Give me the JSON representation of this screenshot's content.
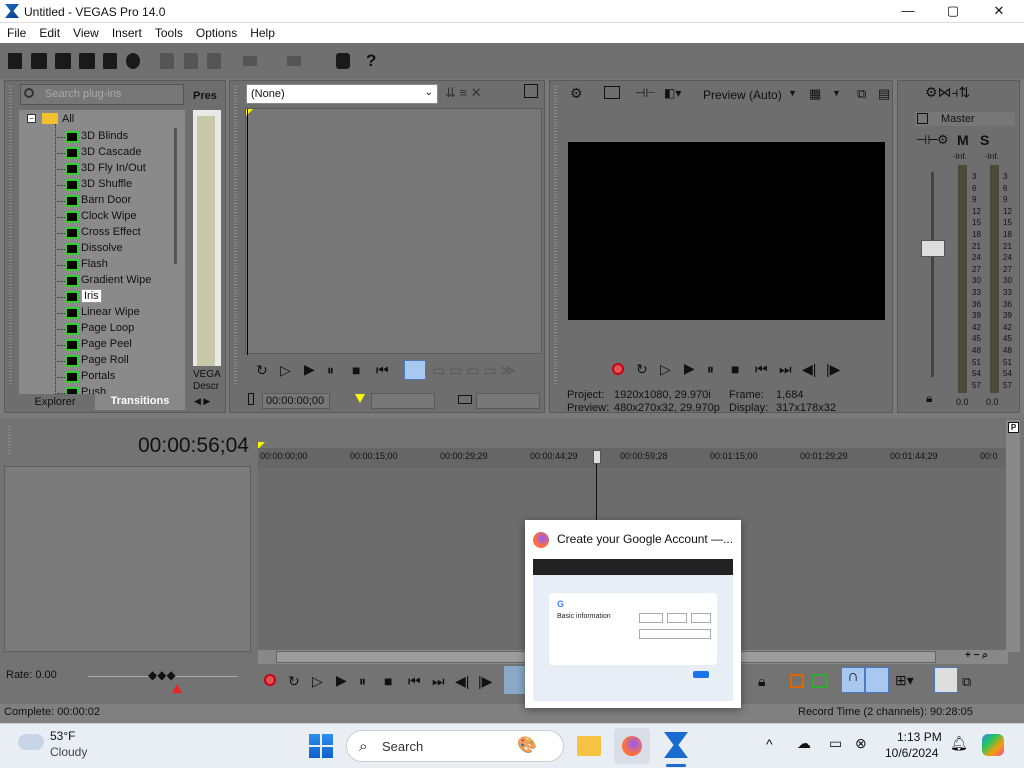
{
  "window": {
    "title": "Untitled - VEGAS Pro 14.0",
    "buttons": [
      "—",
      "▢",
      "✕"
    ]
  },
  "menu": [
    "File",
    "Edit",
    "View",
    "Insert",
    "Tools",
    "Options",
    "Help"
  ],
  "explorer": {
    "search_placeholder": "Search plug-ins",
    "header_label": "Pres",
    "root": "All",
    "items": [
      "3D Blinds",
      "3D Cascade",
      "3D Fly In/Out",
      "3D Shuffle",
      "Barn Door",
      "Clock Wipe",
      "Cross Effect",
      "Dissolve",
      "Flash",
      "Gradient Wipe",
      "Iris",
      "Linear Wipe",
      "Page Loop",
      "Page Peel",
      "Page Roll",
      "Portals",
      "Push"
    ],
    "selected": "Iris",
    "side_text": [
      "VEGA",
      "Descr"
    ],
    "tabs": [
      "Explorer",
      "Transitions"
    ]
  },
  "trimmer": {
    "dropdown": "(None)",
    "timecode": "00:00:00;00"
  },
  "preview": {
    "mode_label": "Preview (Auto)",
    "project_label": "Project:",
    "project_value": "1920x1080, 29.970i",
    "preview_label": "Preview:",
    "preview_value": "480x270x32, 29.970p",
    "frame_label": "Frame:",
    "frame_value": "1,684",
    "display_label": "Display:",
    "display_value": "317x178x32"
  },
  "master": {
    "title": "Master",
    "m": "M",
    "s": "S",
    "peak_left": "-Inf.",
    "peak_right": "-Inf.",
    "ticks": [
      "3",
      "6",
      "9",
      "12",
      "15",
      "18",
      "21",
      "24",
      "27",
      "30",
      "33",
      "36",
      "39",
      "42",
      "45",
      "48",
      "51",
      "54",
      "57"
    ],
    "level_left": "0.0",
    "level_right": "0.0"
  },
  "timeline": {
    "timecode": "00:00:56;04",
    "ruler": [
      "00:00:00;00",
      "00:00:15;00",
      "00:00:29;29",
      "00:00:44;29",
      "00:00:59;28",
      "00:01:15;00",
      "00:01:29;29",
      "00:01:44;29",
      "00:0"
    ],
    "rate": "Rate: 0.00"
  },
  "status": {
    "complete": "Complete: 00:00:02",
    "record": "Record Time (2 channels): 90:28:05"
  },
  "popup": {
    "title": "Create your Google Account —...",
    "heading": "Basic information"
  },
  "taskbar": {
    "temp": "53°F",
    "weather": "Cloudy",
    "search": "Search",
    "time": "1:13 PM",
    "date": "10/6/2024"
  }
}
